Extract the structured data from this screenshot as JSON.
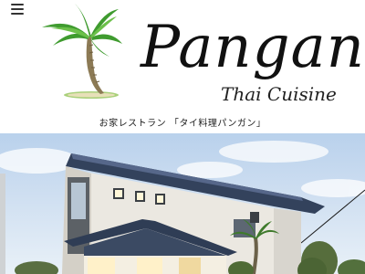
{
  "header": {
    "menu_icon": "hamburger-menu-icon",
    "logo_title": "Pangan",
    "logo_subtitle": "Thai Cuisine",
    "tagline": "お家レストラン 「タイ料理パンガン」"
  },
  "hero": {
    "image": "restaurant-house-photo"
  },
  "colors": {
    "background": "#ffffff",
    "text": "#111111",
    "sky": "#c4d9ef",
    "roof": "#31405a",
    "wall": "#e9e6df"
  }
}
